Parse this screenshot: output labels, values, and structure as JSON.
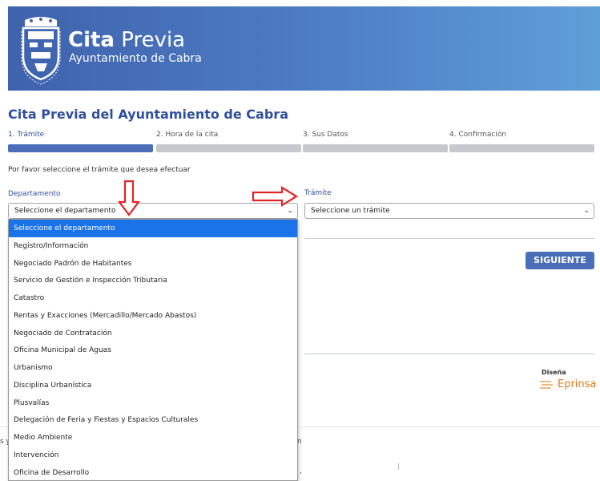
{
  "header": {
    "title_bold": "Cita",
    "title_light": "Previa",
    "subtitle": "Ayuntamiento de Cabra"
  },
  "page_title": "Cita Previa del Ayuntamiento de Cabra",
  "steps": [
    {
      "label": "1. Trámite",
      "active": true
    },
    {
      "label": "2. Hora de la cita",
      "active": false
    },
    {
      "label": "3. Sus Datos",
      "active": false
    },
    {
      "label": "4. Confirmación",
      "active": false
    }
  ],
  "instruction": "Por favor seleccione el trámite que desea efectuar",
  "departamento": {
    "label": "Departamento",
    "selected": "Seleccione el departamento"
  },
  "tramite": {
    "label": "Trámite",
    "selected": "Seleccione un trámite"
  },
  "siguiente_label": "SIGUIENTE",
  "dropdown_options": [
    "Seleccione el departamento",
    "Registro/Información",
    "Negociado Padrón de Habitantes",
    "Servicio de Gestión e Inspección Tributaria",
    "Catastro",
    "Rentas y Exacciones (Mercadillo/Mercado Abastos)",
    "Negociado de Contratación",
    "Oficina Municipal de Aguas",
    "Urbanismo",
    "Disciplina Urbanística",
    "Plusvalías",
    "Delegación de Feria y Fiestas y Espacios Culturales",
    "Medio Ambiente",
    "Intervención",
    "Oficina de Desarrollo"
  ],
  "footer": {
    "disena": "Diseña",
    "eprinsa": "Eprinsa"
  },
  "cookie_fragments": {
    "left": "s y",
    "middle": "n",
    "bottom": ","
  },
  "colors": {
    "accent": "#4a6fb8",
    "title_blue": "#2f4f9e",
    "selected_option": "#1a73e8",
    "annotation_red": "#e0262a"
  }
}
